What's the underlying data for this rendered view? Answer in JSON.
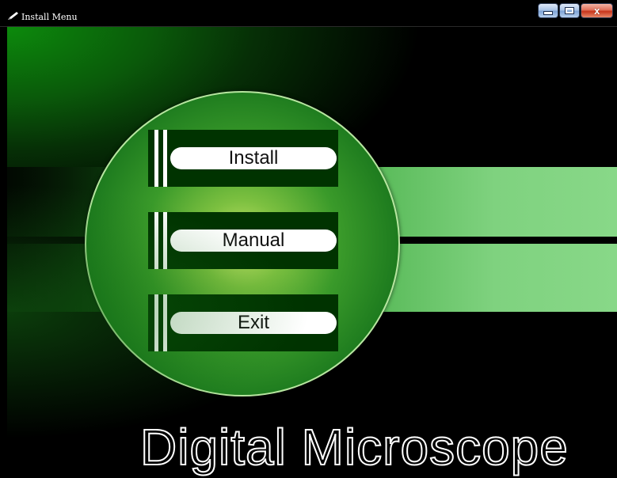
{
  "window": {
    "title": "Install Menu",
    "title_icon": "pencil-icon",
    "controls": {
      "minimize_icon": "minimize-icon",
      "maximize_icon": "maximize-icon",
      "close_label": "x"
    }
  },
  "menu": {
    "items": [
      {
        "id": "install",
        "label": "Install"
      },
      {
        "id": "manual",
        "label": "Manual"
      },
      {
        "id": "exit",
        "label": "Exit"
      }
    ]
  },
  "brand": {
    "text": "Digital Microscope"
  },
  "colors": {
    "accent_green": "#1f7d1f",
    "circle_center": "#c9e66a",
    "button_bg": "#003300",
    "pill_bg": "#ffffff",
    "background": "#000000"
  }
}
